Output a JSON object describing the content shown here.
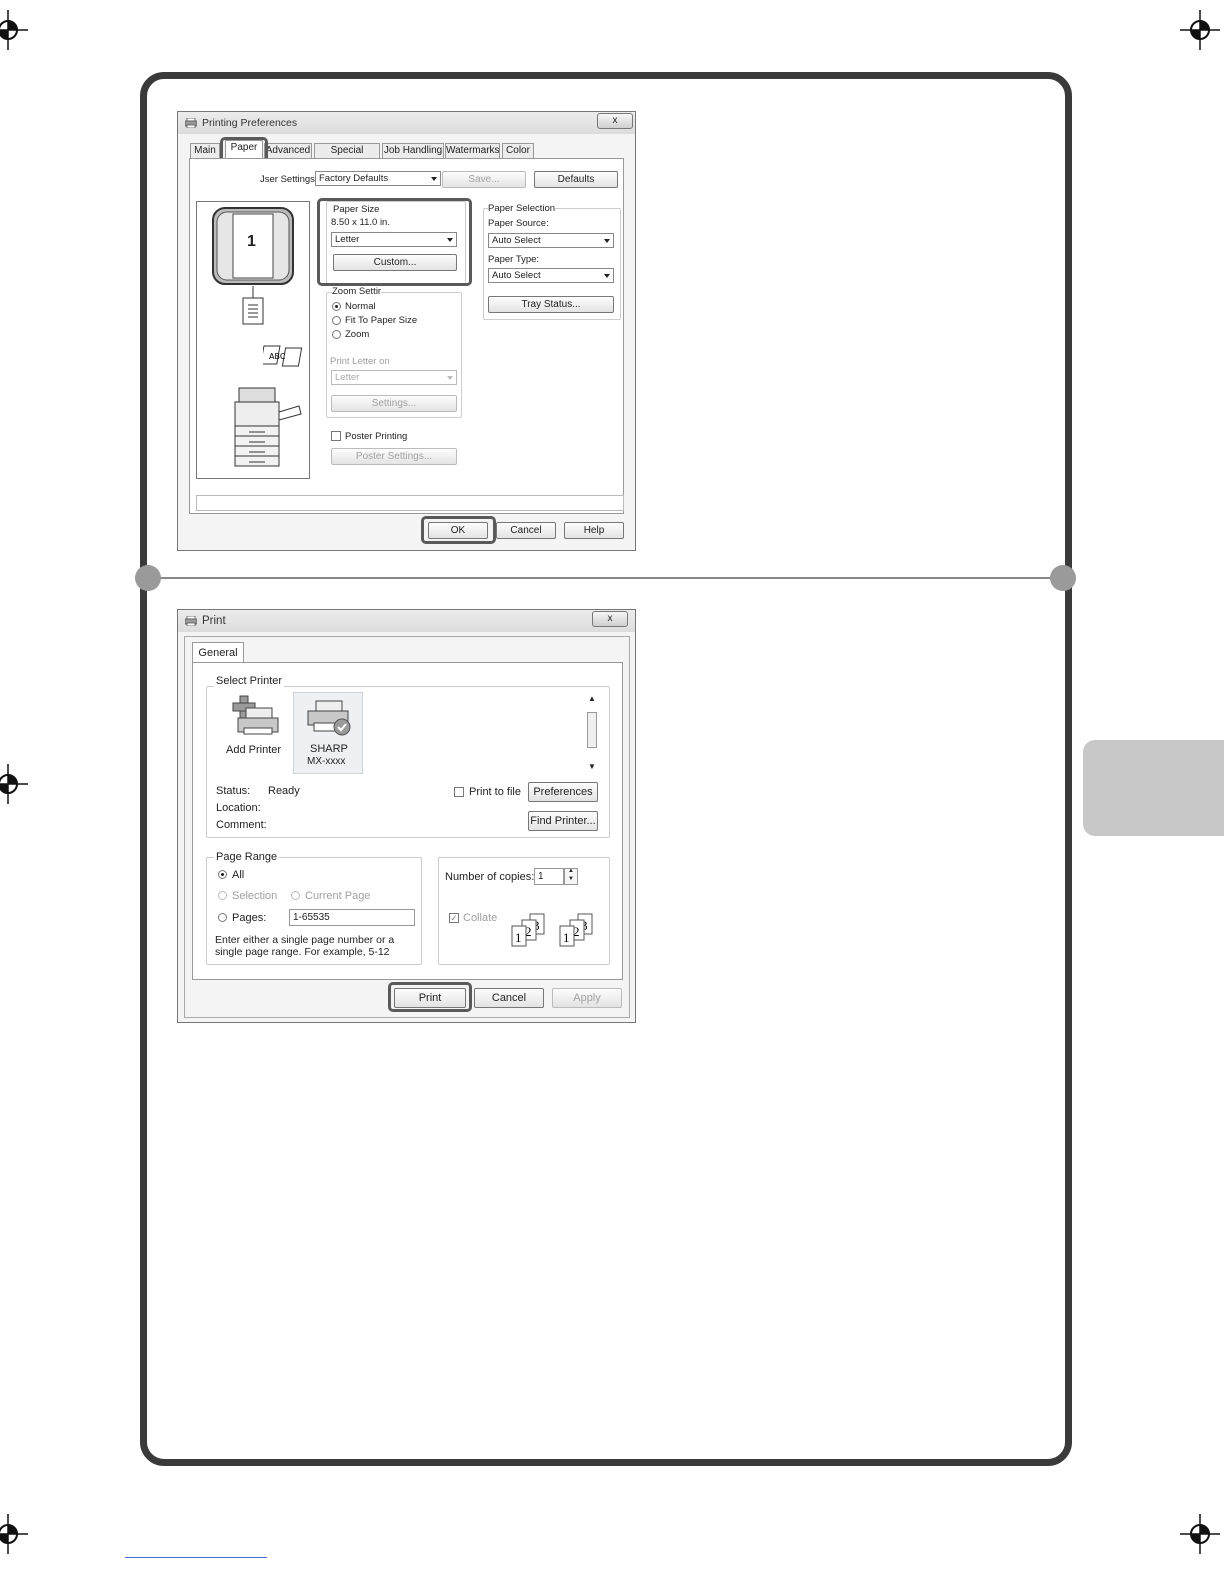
{
  "printing_preferences": {
    "title": "Printing Preferences",
    "close_label": "x",
    "tabs": [
      "Main",
      "Paper",
      "Advanced",
      "Special Modes",
      "Job Handling",
      "Watermarks",
      "Color"
    ],
    "user_settings_label": "Jser Settings:",
    "user_settings_value": "Factory Defaults",
    "save_label": "Save...",
    "defaults_label": "Defaults",
    "preview_page_number": "1",
    "paper_size": {
      "title": "Paper Size",
      "dimensions": "8.50 x 11.0 in.",
      "value": "Letter",
      "custom_label": "Custom..."
    },
    "paper_selection": {
      "title": "Paper Selection",
      "source_label": "Paper Source:",
      "source_value": "Auto Select",
      "type_label": "Paper Type:",
      "type_value": "Auto Select",
      "tray_status_label": "Tray Status..."
    },
    "zoom": {
      "title": "Zoom Settir",
      "options": [
        "Normal",
        "Fit To Paper Size",
        "Zoom"
      ],
      "selected": "Normal"
    },
    "print_letter_on_label": "Print Letter on",
    "print_letter_on_value": "Letter",
    "settings_label": "Settings...",
    "poster_printing_label": "Poster Printing",
    "poster_settings_label": "Poster Settings...",
    "ok_label": "OK",
    "cancel_label": "Cancel",
    "help_label": "Help"
  },
  "print_dialog": {
    "title": "Print",
    "close_label": "x",
    "tab_label": "General",
    "select_printer_title": "Select Printer",
    "printers": [
      {
        "name": "Add Printer",
        "sub": ""
      },
      {
        "name": "SHARP",
        "sub": "MX-xxxx"
      }
    ],
    "status_label": "Status:",
    "status_value": "Ready",
    "location_label": "Location:",
    "comment_label": "Comment:",
    "print_to_file_label": "Print to file",
    "preferences_label": "Preferences",
    "find_printer_label": "Find Printer...",
    "page_range_title": "Page Range",
    "range_all": "All",
    "range_selection": "Selection",
    "range_current_page": "Current Page",
    "range_pages": "Pages:",
    "pages_value": "1-65535",
    "range_hint": "Enter either a single page number or a single page range.  For example, 5-12",
    "copies_label": "Number of copies:",
    "copies_value": "1",
    "collate_label": "Collate",
    "print_label": "Print",
    "cancel_label": "Cancel",
    "apply_label": "Apply"
  }
}
